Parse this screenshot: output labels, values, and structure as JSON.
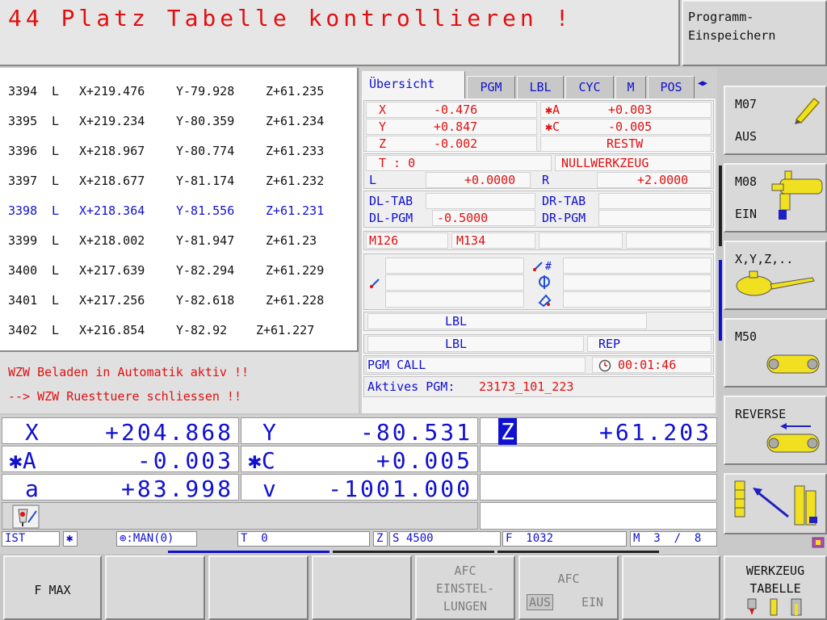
{
  "header": {
    "message": "44 Platz Tabelle kontrollieren !",
    "program_button": "Programm-\nEinspeichern"
  },
  "program_lines": [
    {
      "n": "3394",
      "t": "L",
      "x": "X+219.476",
      "y": "Y-79.928",
      "z": "Z+61.235"
    },
    {
      "n": "3395",
      "t": "L",
      "x": "X+219.234",
      "y": "Y-80.359",
      "z": "Z+61.234"
    },
    {
      "n": "3396",
      "t": "L",
      "x": "X+218.967",
      "y": "Y-80.774",
      "z": "Z+61.233"
    },
    {
      "n": "3397",
      "t": "L",
      "x": "X+218.677",
      "y": "Y-81.174",
      "z": "Z+61.232"
    },
    {
      "n": "3398",
      "t": "L",
      "x": "X+218.364",
      "y": "Y-81.556",
      "z": "Z+61.231"
    },
    {
      "n": "3399",
      "t": "L",
      "x": "X+218.002",
      "y": "Y-81.947",
      "z": "Z+61.23"
    },
    {
      "n": "3400",
      "t": "L",
      "x": "X+217.639",
      "y": "Y-82.294",
      "z": "Z+61.229"
    },
    {
      "n": "3401",
      "t": "L",
      "x": "X+217.256",
      "y": "Y-82.618",
      "z": "Z+61.228"
    },
    {
      "n": "3402",
      "t": "L",
      "x": "X+216.854",
      "y": "Y-82.92",
      "z": "Z+61.227"
    }
  ],
  "errors": [
    "WZW Beladen in Automatik aktiv !!",
    "--> WZW Ruesttuere schliessen !!"
  ],
  "tabs": [
    "Übersicht",
    "PGM",
    "LBL",
    "CYC",
    "M",
    "POS"
  ],
  "tab_scroll": "◀▶",
  "overview": {
    "x_label": "X",
    "x_val": "-0.476",
    "y_label": "Y",
    "y_val": "+0.847",
    "z_label": "Z",
    "z_val": "-0.002",
    "a_label": "✱A",
    "a_val": "+0.003",
    "c_label": "✱C",
    "c_val": "-0.005",
    "restw": "RESTW",
    "tool_label": "T : 0",
    "tool_name": "NULLWERKZEUG",
    "l_label": "L",
    "l_val": "+0.0000",
    "r_label": "R",
    "r_val": "+2.0000",
    "dl_tab": "DL-TAB",
    "dr_tab": "DR-TAB",
    "dl_pgm": "DL-PGM",
    "dl_pgm_val": "-0.5000",
    "dr_pgm": "DR-PGM",
    "m126": "M126",
    "m134": "M134",
    "lbl1": "LBL",
    "lbl2": "LBL",
    "rep": "REP",
    "pgm_call": "PGM CALL",
    "time": "00:01:46",
    "active_pgm_label": "Aktives PGM:",
    "active_pgm": "23173_101_223"
  },
  "axes": {
    "x_name": "X",
    "x_val": "+204.868",
    "y_name": "Y",
    "y_val": "-80.531",
    "z_name": "Z",
    "z_val": "+61.203",
    "a_name": "✱A",
    "a_val": "-0.003",
    "c_name": "✱C",
    "c_val": "+0.005",
    "alpha_name": "a",
    "alpha_val": "+83.998",
    "v_name": "v",
    "v_val": "-1001.000"
  },
  "status_bar": {
    "ist": "IST",
    "star": "✱",
    "datum": "⊕:MAN(0)",
    "tool": "T  0",
    "z": "Z",
    "s": "S 4500",
    "f": "F  1032",
    "m": "M  3  /  8"
  },
  "right_keys": {
    "m07": "M07",
    "aus": "AUS",
    "m08": "M08",
    "ein": "EIN",
    "xyz": "X,Y,Z,..",
    "m50": "M50",
    "reverse": "REVERSE"
  },
  "bottom_keys": {
    "fmax": "F MAX",
    "afc1": "AFC",
    "afc1b": "EINSTEL-",
    "afc1c": "LUNGEN",
    "afc2": "AFC",
    "afc2_aus": "AUS",
    "afc2_ein": "EIN",
    "wz1": "WERKZEUG",
    "wz2": "TABELLE"
  },
  "colors": {
    "accent": "#1010d0",
    "alert": "#e01010",
    "tool_yellow": "#f0e020"
  }
}
